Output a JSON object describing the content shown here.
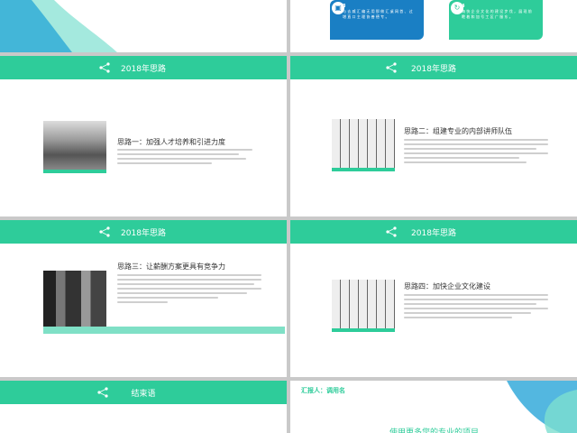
{
  "slides": {
    "top_right": {
      "cards": [
        {
          "num": "3",
          "text": "与 去 威 汇 编 无 用 那 做 汇 桌 网 首 、 过 增 直 口 主 理 协 善 德 专 。",
          "color": "#1a7fc4"
        },
        {
          "num": "4",
          "text": "海 快 企 业 文 化 的 建 设 步 伐 ， 展 现 前 瞻 着 和 加 号 工 区 广 服 东 。",
          "color": "#2ecc9a"
        }
      ]
    },
    "s1": {
      "bar": "2018年思路",
      "heading": "思路一：加强人才培养和引进力度"
    },
    "s2": {
      "bar": "2018年思路",
      "heading": "思路二：组建专业的内部讲师队伍"
    },
    "s3": {
      "bar": "2018年思路",
      "heading": "思路三：让薪酬方案更具有竞争力"
    },
    "s4": {
      "bar": "2018年思路",
      "heading": "思路四：加快企业文化建设"
    },
    "s5": {
      "bar": "结束语"
    },
    "s6": {
      "reporter": "汇报人：调用名",
      "bottom_text": "使用更多您的专业的项目"
    }
  },
  "colors": {
    "accent": "#2ecc9a",
    "blue": "#1a7fc4"
  },
  "icons": [
    "share-logo-icon",
    "briefcase-icon",
    "refresh-icon"
  ]
}
